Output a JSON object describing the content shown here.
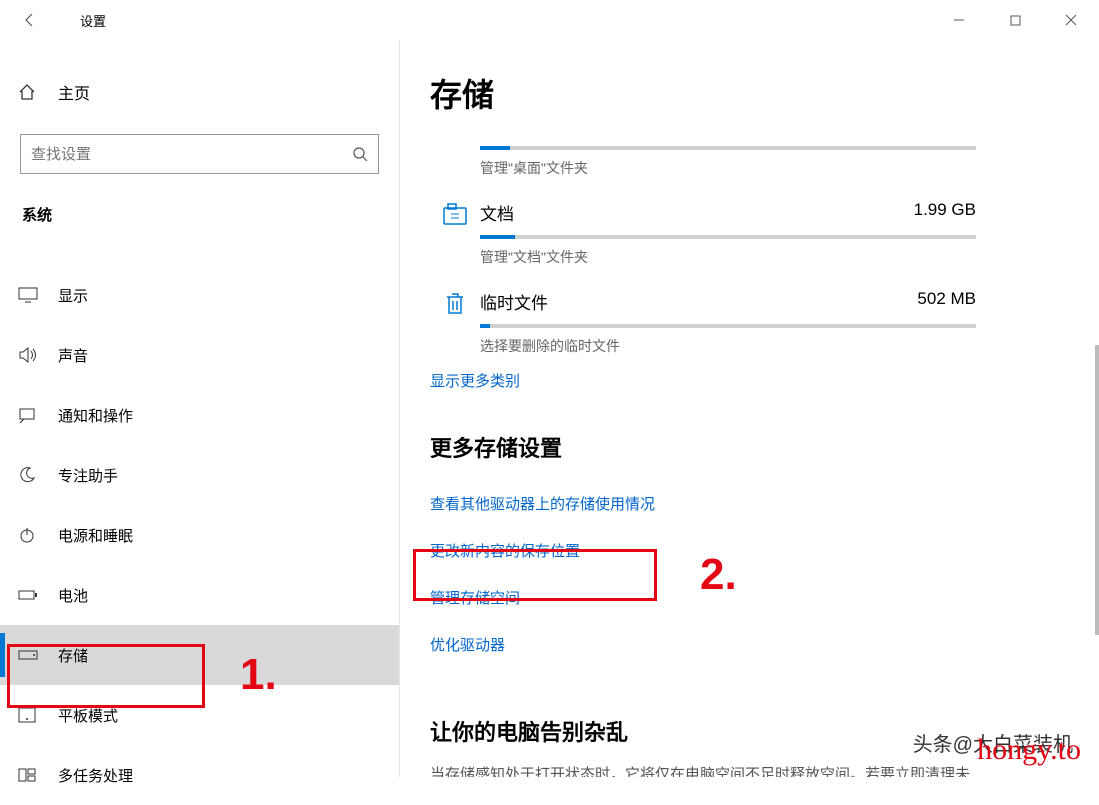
{
  "titlebar": {
    "title": "设置"
  },
  "sidebar": {
    "home": "主页",
    "search_placeholder": "查找设置",
    "section": "系统",
    "items": [
      {
        "label": "显示",
        "icon": "display"
      },
      {
        "label": "声音",
        "icon": "sound"
      },
      {
        "label": "通知和操作",
        "icon": "notify"
      },
      {
        "label": "专注助手",
        "icon": "moon"
      },
      {
        "label": "电源和睡眠",
        "icon": "power"
      },
      {
        "label": "电池",
        "icon": "battery"
      },
      {
        "label": "存储",
        "icon": "storage",
        "selected": true
      },
      {
        "label": "平板模式",
        "icon": "tablet"
      },
      {
        "label": "多任务处理",
        "icon": "multitask"
      }
    ]
  },
  "main": {
    "title": "存储",
    "top_sub": "管理\"桌面\"文件夹",
    "items": [
      {
        "title": "文档",
        "size": "1.99 GB",
        "sub": "管理\"文档\"文件夹",
        "fill": 7
      },
      {
        "title": "临时文件",
        "size": "502 MB",
        "sub": "选择要删除的临时文件",
        "fill": 2
      }
    ],
    "show_more": "显示更多类别",
    "more_heading": "更多存储设置",
    "links": [
      "查看其他驱动器上的存储使用情况",
      "更改新内容的保存位置",
      "管理存储空间",
      "优化驱动器"
    ],
    "declutter": "让你的电脑告别杂乱",
    "declutter_text": "当存储感知处于打开状态时，它将仅在电脑空间不足时释放空间。若要立即清理未"
  },
  "annotations": {
    "a1": "1.",
    "a2": "2."
  },
  "watermark": {
    "w1": "头条@大白菜装机",
    "w2": "hongy.to"
  }
}
